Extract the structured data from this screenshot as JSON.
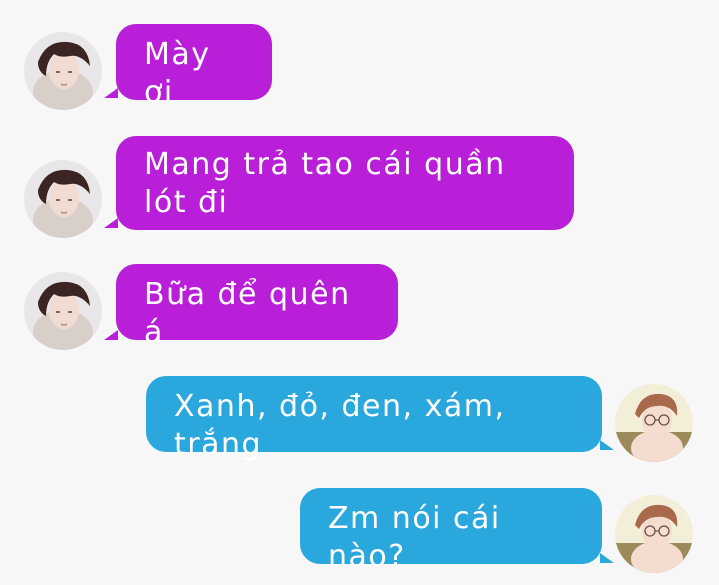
{
  "colors": {
    "background": "#f7f7f7",
    "incoming_bubble": "#b91fd8",
    "outgoing_bubble": "#2aa8dd",
    "text": "#ffffff"
  },
  "messages": [
    {
      "sender": "contact",
      "avatar": "dark-haired-boy-avatar",
      "text": "Mày ơi"
    },
    {
      "sender": "contact",
      "avatar": "dark-haired-boy-avatar",
      "text": "Mang trả tao cái quần lót đi"
    },
    {
      "sender": "contact",
      "avatar": "dark-haired-boy-avatar",
      "text": "Bữa để quên á"
    },
    {
      "sender": "me",
      "avatar": "glasses-boy-avatar",
      "text": "Xanh, đỏ, đen, xám, trắng"
    },
    {
      "sender": "me",
      "avatar": "glasses-boy-avatar",
      "text": "Zm nói cái nào?"
    }
  ]
}
